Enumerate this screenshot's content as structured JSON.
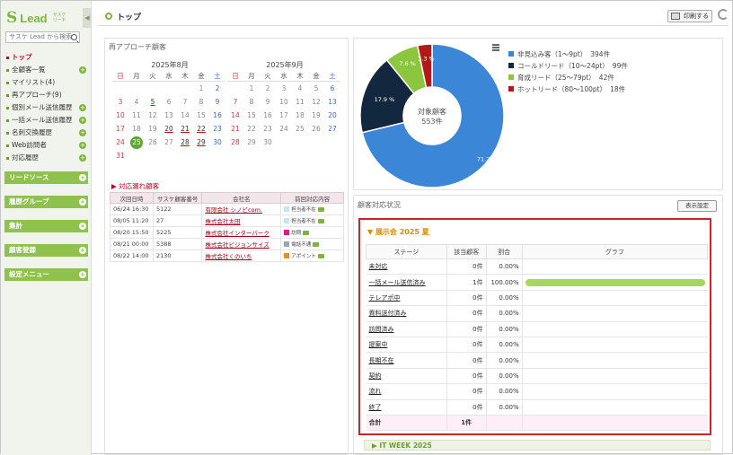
{
  "app": {
    "logo_mark": "S",
    "logo_text": "Lead",
    "logo_sub1": "サスケ",
    "logo_sub2": "リード",
    "collapse": "◀"
  },
  "search": {
    "placeholder": "サスケ Lead から検索"
  },
  "nav": [
    {
      "label": "トップ",
      "plus": false
    },
    {
      "label": "全顧客一覧",
      "plus": true
    },
    {
      "label": "マイリスト(4)",
      "plus": false
    },
    {
      "label": "再アプローチ(9)",
      "plus": false
    },
    {
      "label": "個別メール送信履歴",
      "plus": true
    },
    {
      "label": "一括メール送信履歴",
      "plus": true
    },
    {
      "label": "名刺交換履歴",
      "plus": true
    },
    {
      "label": "Web訪問者",
      "plus": true
    },
    {
      "label": "対応履歴",
      "plus": true
    }
  ],
  "sections": [
    "リードソース",
    "履歴グループ",
    "集計",
    "顧客登録",
    "設定メニュー"
  ],
  "header": {
    "title": "トップ",
    "print_label": "印刷する"
  },
  "reapproach": {
    "title": "再アプローチ顧客"
  },
  "weekdays": [
    "日",
    "月",
    "火",
    "水",
    "木",
    "金",
    "土"
  ],
  "calendars": [
    {
      "month": "2025年8月",
      "weeks": [
        [
          "",
          "",
          "",
          "",
          "",
          "1",
          "2"
        ],
        [
          "3",
          "4",
          "5",
          "6",
          "7",
          "8",
          "9"
        ],
        [
          "10",
          "11",
          "12",
          "13",
          "14",
          "15",
          "16"
        ],
        [
          "17",
          "18",
          "19",
          "20",
          "21",
          "22",
          "23"
        ],
        [
          "24",
          "25",
          "26",
          "27",
          "28",
          "29",
          "30"
        ],
        [
          "31",
          "",
          "",
          "",
          "",
          "",
          ""
        ]
      ],
      "underlined": [
        "5",
        "20",
        "21",
        "22",
        "28",
        "29"
      ],
      "today": "25"
    },
    {
      "month": "2025年9月",
      "weeks": [
        [
          "",
          "1",
          "2",
          "3",
          "4",
          "5",
          "6"
        ],
        [
          "7",
          "8",
          "9",
          "10",
          "11",
          "12",
          "13"
        ],
        [
          "14",
          "15",
          "16",
          "17",
          "18",
          "19",
          "20"
        ],
        [
          "21",
          "22",
          "23",
          "24",
          "25",
          "26",
          "27"
        ],
        [
          "28",
          "29",
          "30",
          "",
          "",
          "",
          ""
        ]
      ],
      "underlined": [],
      "today": ""
    }
  ],
  "missed": {
    "title": "▶ 対応漏れ顧客",
    "headers": [
      "次回日時",
      "サスケ顧客番号",
      "会社名",
      "前回対応内容"
    ],
    "rows": [
      {
        "date": "06/24 16:30",
        "id": "5122",
        "company": "有限会社 シノビcom.",
        "status": "担当者不在",
        "color": "#bfe8ef"
      },
      {
        "date": "08/05 11:20",
        "id": "27",
        "company": "株式会社太田",
        "status": "担当者不在",
        "color": "#bfe8ef"
      },
      {
        "date": "08/20 15:50",
        "id": "5225",
        "company": "株式会社インターパーク",
        "status": "訪問",
        "color": "#e0198a"
      },
      {
        "date": "08/21 00:00",
        "id": "5388",
        "company": "株式会社ビジョンサイズ",
        "status": "電話不通",
        "color": "#9aa7a5"
      },
      {
        "date": "08/22 14:00",
        "id": "2130",
        "company": "株式会社くのいち",
        "status": "アポイント",
        "color": "#f08a18"
      }
    ]
  },
  "pie": {
    "center_line1": "対象顧客",
    "center_line2": "553件",
    "colors": [
      "#3b86d6",
      "#13283f",
      "#8cc63f",
      "#b21a1a"
    ]
  },
  "chart_data": {
    "type": "pie",
    "labels": [
      "非見込み客（1〜9pt）",
      "コールドリード（10〜24pt）",
      "育成リード（25〜79pt）",
      "ホットリード（80〜100pt）"
    ],
    "counts": [
      "394件",
      "99件",
      "42件",
      "18件"
    ],
    "values": [
      394,
      99,
      42,
      18
    ],
    "percent_labels": [
      "71.2 %",
      "17.9 %",
      "7.6 %",
      "3.3 %"
    ]
  },
  "status": {
    "title": "顧客対応状況",
    "settings_label": "表示設定",
    "event": "▼ 展示会 2025 夏",
    "headers": [
      "ステージ",
      "該当顧客",
      "割合",
      "グラフ"
    ],
    "rows": [
      {
        "stage": "未対応",
        "count": "0件",
        "pct": "0.00%",
        "fill": 0
      },
      {
        "stage": "一括メール送信済み",
        "count": "1件",
        "pct": "100.00%",
        "fill": 1
      },
      {
        "stage": "テレアポ中",
        "count": "0件",
        "pct": "0.00%",
        "fill": 0
      },
      {
        "stage": "資料送付済み",
        "count": "0件",
        "pct": "0.00%",
        "fill": 0
      },
      {
        "stage": "訪問済み",
        "count": "0件",
        "pct": "0.00%",
        "fill": 0
      },
      {
        "stage": "提案中",
        "count": "0件",
        "pct": "0.00%",
        "fill": 0
      },
      {
        "stage": "長期不在",
        "count": "0件",
        "pct": "0.00%",
        "fill": 0
      },
      {
        "stage": "契約",
        "count": "0件",
        "pct": "0.00%",
        "fill": 0
      },
      {
        "stage": "流れ",
        "count": "0件",
        "pct": "0.00%",
        "fill": 0
      },
      {
        "stage": "終了",
        "count": "0件",
        "pct": "0.00%",
        "fill": 0
      }
    ],
    "total_label": "合計",
    "total_count": "1件",
    "next_event": "▶ IT WEEK 2025"
  }
}
